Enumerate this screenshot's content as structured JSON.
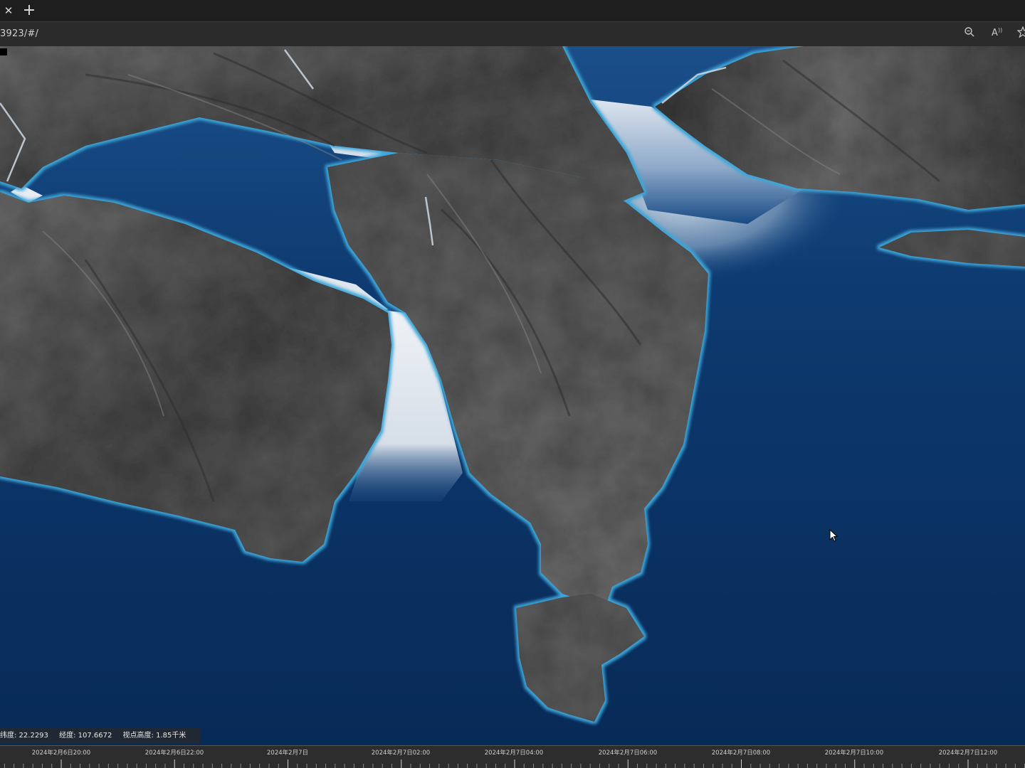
{
  "browser": {
    "close_tab_icon": "close-icon",
    "new_tab_icon": "plus-icon",
    "url": "3923/#/",
    "zoom_icon": "zoom-out-icon",
    "read_aloud_icon": "read-aloud-icon",
    "favorite_icon": "star-icon"
  },
  "status": {
    "lat": "纬度: 22.2293",
    "lon": "经度: 107.6672",
    "height": "视点高度: 1.85千米"
  },
  "timeline": {
    "labels": [
      "2024年2月6日20:00",
      "2024年2月6日22:00",
      "2024年2月7日",
      "2024年2月7日02:00",
      "2024年2月7日04:00",
      "2024年2月7日06:00",
      "2024年2月7日08:00",
      "2024年2月7日10:00",
      "2024年2月7日12:00"
    ]
  },
  "colors": {
    "water": "#0b3163",
    "terrain": "#5a5a5a",
    "shore": "#3ca6d8"
  }
}
